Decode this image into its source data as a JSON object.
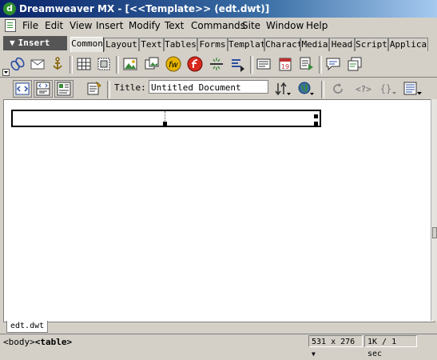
{
  "window": {
    "title": "Dreamweaver MX - [<<Template>> (edt.dwt)]"
  },
  "menu": [
    "File",
    "Edit",
    "View",
    "Insert",
    "Modify",
    "Text",
    "Commands",
    "Site",
    "Window",
    "Help"
  ],
  "insert_bar": {
    "label": "Insert",
    "tabs": [
      "Common",
      "Layout",
      "Text",
      "Tables",
      "Forms",
      "Templat",
      "Charact",
      "Media",
      "Head",
      "Script",
      "Applica"
    ],
    "active_tab": "Common"
  },
  "document_toolbar": {
    "title_label": "Title:",
    "title_value": "Untitled Document"
  },
  "document_tabs": [
    "edt.dwt"
  ],
  "status": {
    "tags": [
      "<body>",
      "<table>"
    ],
    "window_size": "531 x 276",
    "download_stats": "1K / 1 sec"
  }
}
